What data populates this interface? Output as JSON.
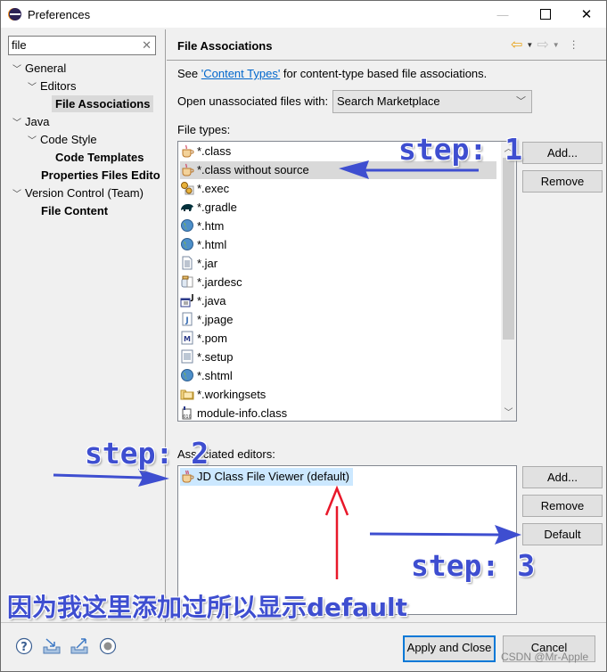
{
  "window": {
    "title": "Preferences",
    "minimize": "—",
    "close": "✕"
  },
  "sidebar": {
    "filter_value": "file",
    "clear_icon": "✕",
    "tree": [
      {
        "label": "General",
        "expanded": true,
        "bold": false
      },
      {
        "label": "Editors",
        "expanded": true,
        "bold": false
      },
      {
        "label": "File Associations",
        "bold": true,
        "selected": true
      },
      {
        "label": "Java",
        "expanded": true,
        "bold": false
      },
      {
        "label": "Code Style",
        "expanded": true,
        "bold": false
      },
      {
        "label": "Code Templates",
        "bold": true
      },
      {
        "label": "Properties Files Edito",
        "bold": true
      },
      {
        "label": "Version Control (Team)",
        "expanded": true,
        "bold": false
      },
      {
        "label": "File Content",
        "bold": true
      }
    ],
    "chevron": "⌄"
  },
  "page": {
    "title": "File Associations",
    "desc_prefix": "See ",
    "desc_link": "'Content Types'",
    "desc_suffix": " for content-type based file associations.",
    "open_label": "Open unassociated files with:",
    "open_value": "Search Marketplace",
    "file_types_label": "File types:",
    "file_types": [
      {
        "name": "*.class",
        "icon": "java-class-icon"
      },
      {
        "name": "*.class without source",
        "icon": "java-class-icon",
        "selected": true
      },
      {
        "name": "*.exec",
        "icon": "gears-icon"
      },
      {
        "name": "*.gradle",
        "icon": "gradle-elephant-icon"
      },
      {
        "name": "*.htm",
        "icon": "globe-icon"
      },
      {
        "name": "*.html",
        "icon": "globe-icon"
      },
      {
        "name": "*.jar",
        "icon": "text-file-icon"
      },
      {
        "name": "*.jardesc",
        "icon": "jar-desc-icon"
      },
      {
        "name": "*.java",
        "icon": "java-file-icon"
      },
      {
        "name": "*.jpage",
        "icon": "jpage-icon"
      },
      {
        "name": "*.pom",
        "icon": "maven-pom-icon"
      },
      {
        "name": "*.setup",
        "icon": "setup-icon"
      },
      {
        "name": "*.shtml",
        "icon": "globe-icon"
      },
      {
        "name": "*.workingsets",
        "icon": "folder-icon"
      },
      {
        "name": "module-info.class",
        "icon": "binary-class-icon"
      }
    ],
    "file_type_buttons": {
      "add": "Add...",
      "remove": "Remove"
    },
    "editors_label": "Associated editors:",
    "editors": [
      {
        "name": "JD Class File Viewer (default)",
        "icon": "java-class-icon"
      }
    ],
    "editor_buttons": {
      "add": "Add...",
      "remove": "Remove",
      "default": "Default"
    }
  },
  "footer": {
    "apply_close": "Apply and Close",
    "cancel": "Cancel"
  },
  "annotations": {
    "step1": "step: 1",
    "step2": "step: 2",
    "step3": "step: 3",
    "note": "因为我这里添加过所以显示default",
    "watermark": "CSDN @Mr-Apple"
  },
  "colors": {
    "annotation": "#3e4ed0",
    "arrow_red": "#e8182a",
    "selection": "#d9d9d9",
    "editor_selection": "#cce8ff",
    "link": "#0066cc",
    "focus_border": "#0078d7"
  }
}
